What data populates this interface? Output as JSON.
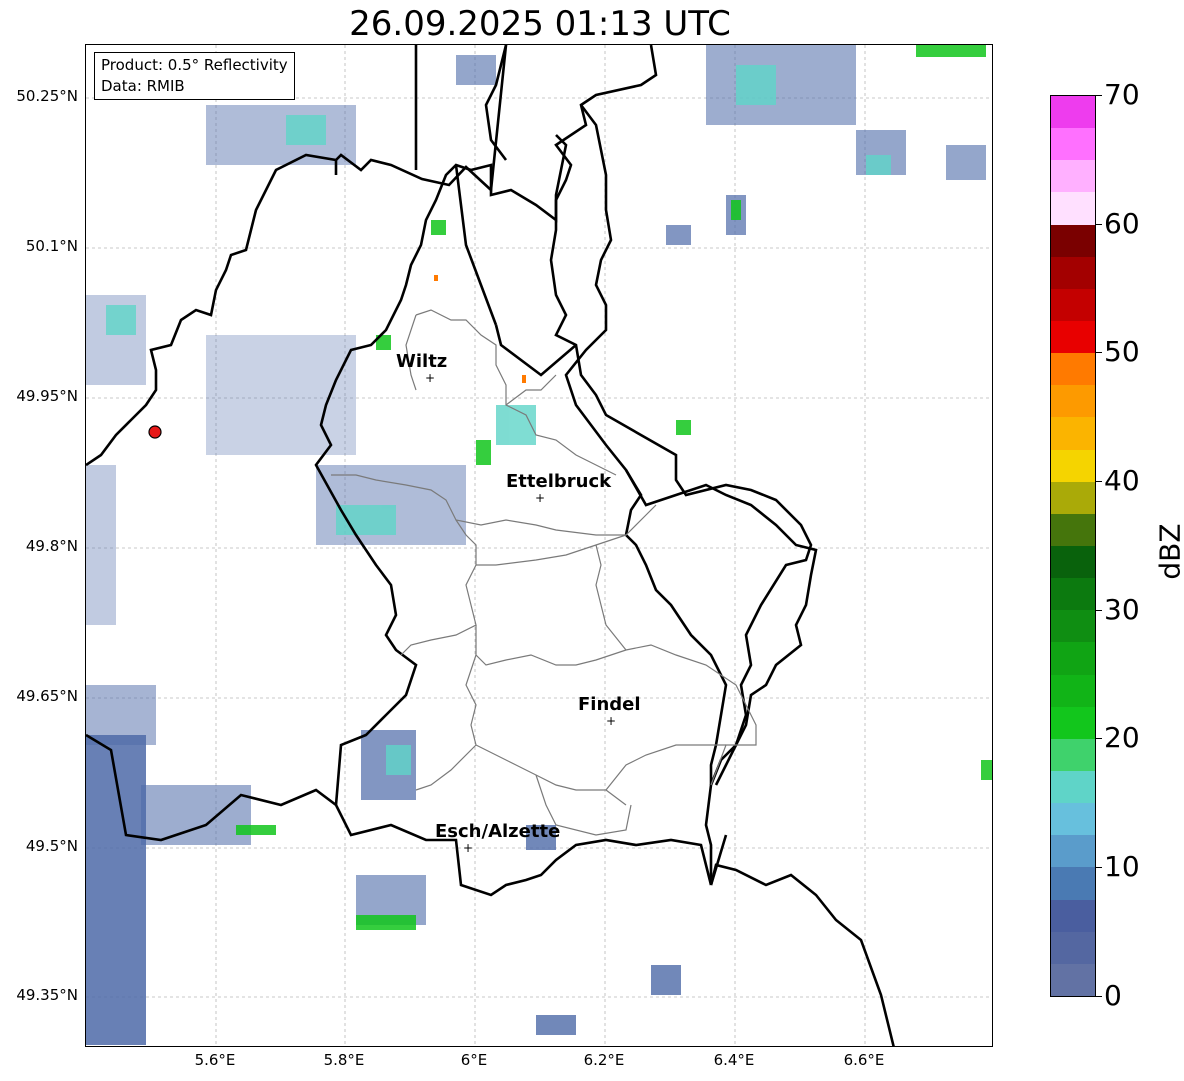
{
  "title": "26.09.2025 01:13 UTC",
  "info": {
    "product": "Product: 0.5° Reflectivity",
    "data": "Data: RMIB"
  },
  "axes": {
    "y_labels": [
      "50.25°N",
      "50.1°N",
      "49.95°N",
      "49.8°N",
      "49.65°N",
      "49.5°N",
      "49.35°N"
    ],
    "x_labels": [
      "5.6°E",
      "5.8°E",
      "6°E",
      "6.2°E",
      "6.4°E",
      "6.6°E"
    ]
  },
  "cities": [
    {
      "name": "Wiltz"
    },
    {
      "name": "Ettelbruck"
    },
    {
      "name": "Findel"
    },
    {
      "name": "Esch/Alzette"
    }
  ],
  "colorbar": {
    "label": "dBZ",
    "ticks": [
      "0",
      "10",
      "20",
      "30",
      "40",
      "50",
      "60",
      "70"
    ],
    "colors": [
      "#6272a4",
      "#5467a1",
      "#4a5e9f",
      "#4a7ab3",
      "#5a9ccb",
      "#67c0dd",
      "#5fd4c8",
      "#3fd26c",
      "#12c61c",
      "#11b417",
      "#10a414",
      "#0f8e12",
      "#0c7a0f",
      "#09620c",
      "#45750c",
      "#aaaa08",
      "#f5d400",
      "#fbb400",
      "#fd9a00",
      "#ff7a00",
      "#e80000",
      "#c40000",
      "#a30000",
      "#7a0000",
      "#ffe0ff",
      "#ffb0ff",
      "#ff70ff",
      "#ee3cee"
    ]
  },
  "radar_site_color": "#e81818"
}
